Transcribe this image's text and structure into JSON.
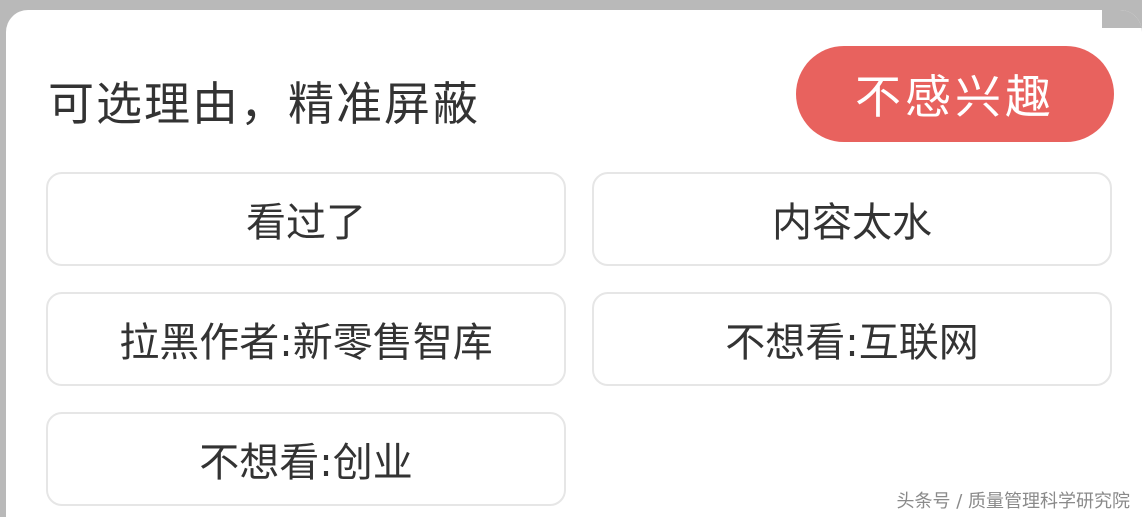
{
  "panel": {
    "title": "可选理由，精准屏蔽",
    "dislike_button_label": "不感兴趣"
  },
  "reasons": [
    {
      "label": "看过了"
    },
    {
      "label": "内容太水"
    },
    {
      "label": "拉黑作者:新零售智库"
    },
    {
      "label": "不想看:互联网"
    },
    {
      "label": "不想看:创业"
    }
  ],
  "watermark": "头条号 / 质量管理科学研究院",
  "colors": {
    "accent": "#e8625e",
    "text": "#333333",
    "border": "#e6e6e6",
    "background": "#ffffff"
  }
}
